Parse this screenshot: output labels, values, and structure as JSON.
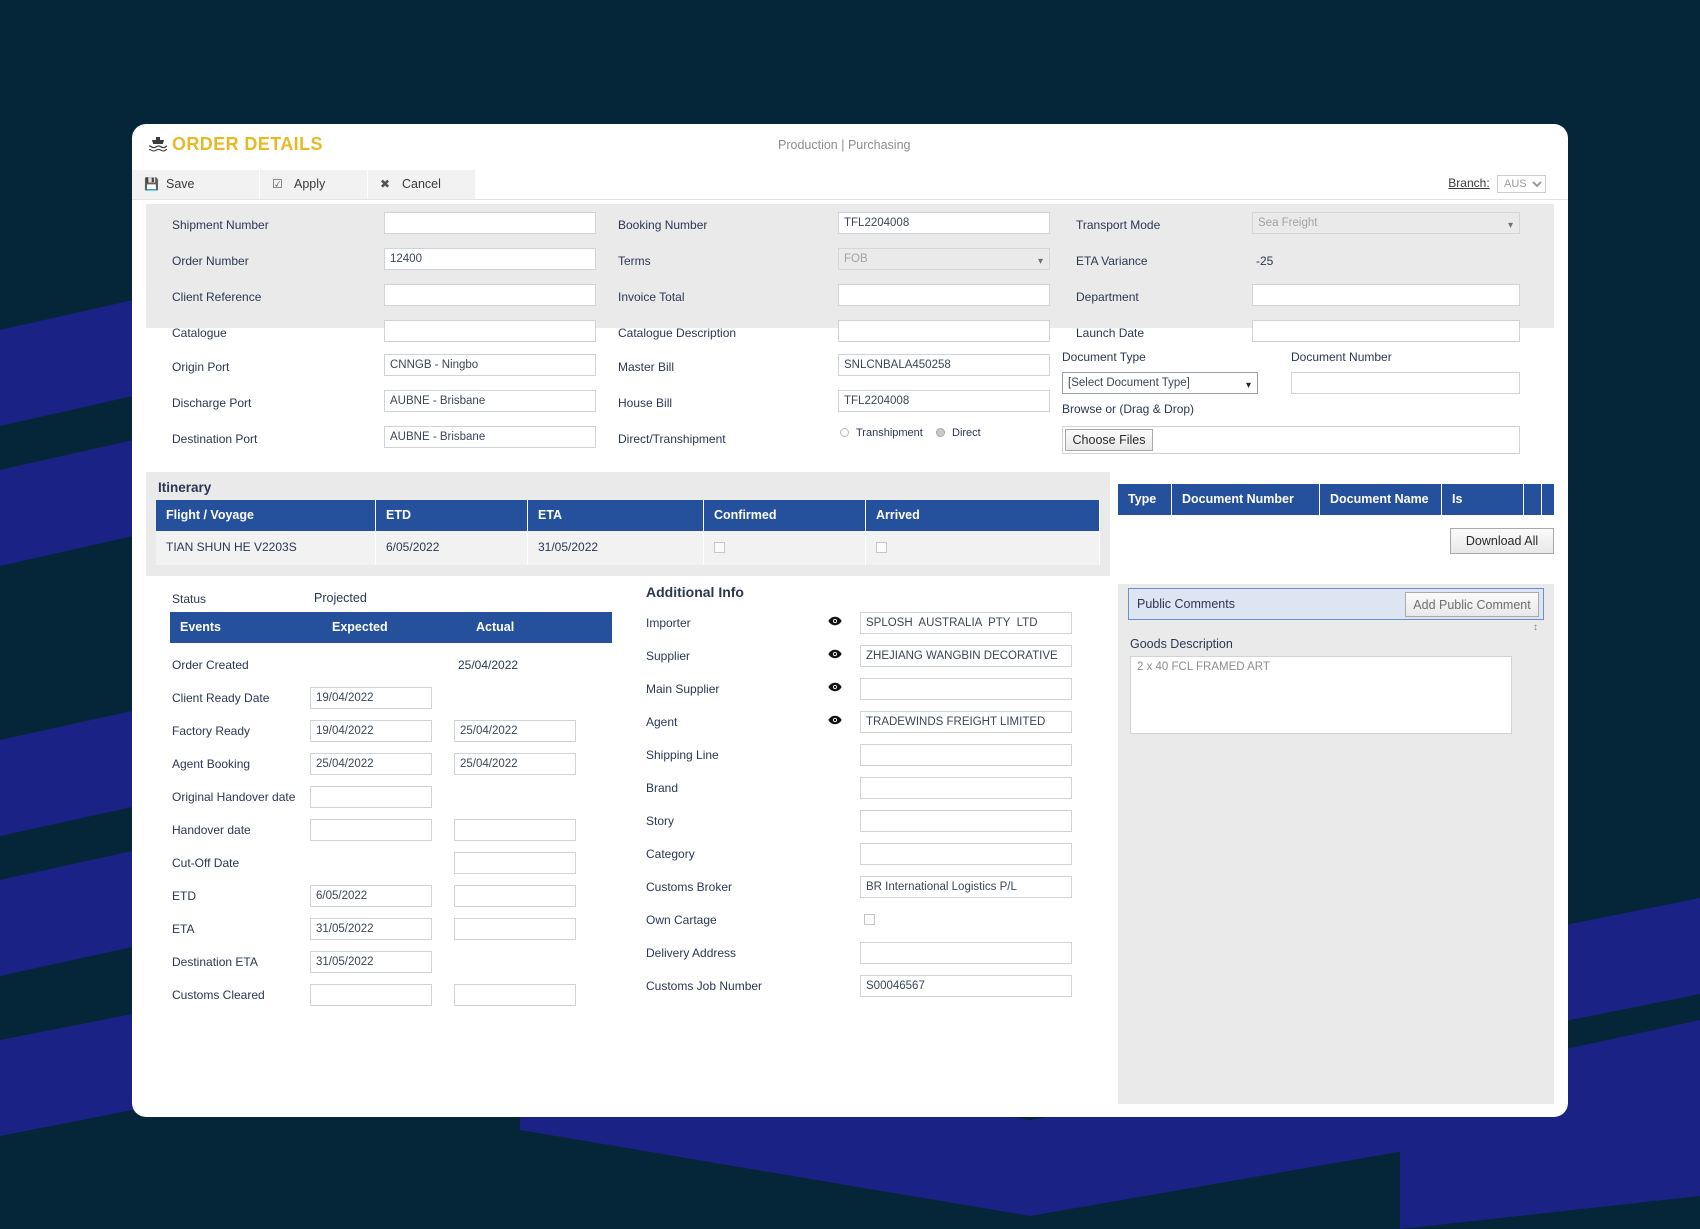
{
  "theme": {
    "bg_dark": "#042638",
    "bg_stripe": "#1b2285",
    "accent_gold": "#e8b927",
    "table_header_blue": "#25509c",
    "panel_grey": "#eaeaea"
  },
  "header": {
    "title": "ORDER DETAILS",
    "ship_icon": "ship-icon",
    "breadcrumb": "Production | Purchasing",
    "branch_label": "Branch:",
    "branch_value": "AUS"
  },
  "toolbar": {
    "save_label": "Save",
    "apply_label": "Apply",
    "cancel_label": "Cancel",
    "save_icon": "save-icon",
    "apply_icon": "checkbox-icon",
    "cancel_icon": "cross-icon"
  },
  "top_form": {
    "col1": [
      {
        "label": "Shipment Number",
        "value": "",
        "type": "text"
      },
      {
        "label": "Order Number",
        "value": "12400",
        "type": "text"
      },
      {
        "label": "Client Reference",
        "value": "",
        "type": "text"
      },
      {
        "label": "Catalogue",
        "value": "",
        "type": "text"
      }
    ],
    "col2": [
      {
        "label": "Booking Number",
        "value": "TFL2204008",
        "type": "text"
      },
      {
        "label": "Terms",
        "value": "FOB",
        "type": "select",
        "disabled": true
      },
      {
        "label": "Invoice Total",
        "value": "",
        "type": "text"
      },
      {
        "label": "Catalogue Description",
        "value": "",
        "type": "text"
      }
    ],
    "col3": [
      {
        "label": "Transport Mode",
        "value": "Sea Freight",
        "type": "select",
        "disabled": true
      },
      {
        "label": "ETA Variance",
        "value": "-25",
        "type": "static"
      },
      {
        "label": "Department",
        "value": "",
        "type": "text"
      },
      {
        "label": "Launch Date",
        "value": "",
        "type": "text"
      }
    ]
  },
  "ports_form": {
    "col1": [
      {
        "label": "Origin Port",
        "value": "CNNGB - Ningbo"
      },
      {
        "label": "Discharge Port",
        "value": "AUBNE - Brisbane"
      },
      {
        "label": "Destination Port",
        "value": "AUBNE - Brisbane"
      }
    ],
    "col2": [
      {
        "label": "Master Bill",
        "value": "SNLCNBALA450258"
      },
      {
        "label": "House Bill",
        "value": "TFL2204008"
      }
    ],
    "direct_transhipment": {
      "label": "Direct/Transhipment",
      "option_transhipment": "Transhipment",
      "option_direct": "Direct",
      "selected": "Direct"
    }
  },
  "documents_upload": {
    "document_type_label": "Document Type",
    "document_type_value": "[Select Document Type]",
    "document_number_label": "Document Number",
    "document_number_value": "",
    "browse_label": "Browse or (Drag & Drop)",
    "choose_files_label": "Choose Files"
  },
  "itinerary": {
    "title": "Itinerary",
    "columns": [
      "Flight / Voyage",
      "ETD",
      "ETA",
      "Confirmed",
      "Arrived"
    ],
    "rows": [
      {
        "voyage": "TIAN SHUN HE V2203S",
        "etd": "6/05/2022",
        "eta": "31/05/2022",
        "confirmed": false,
        "arrived": false
      }
    ]
  },
  "documents_table": {
    "columns": [
      "Type",
      "Document Number",
      "Document Name",
      "Is Approved",
      "",
      ""
    ],
    "rows": [],
    "download_all_label": "Download All"
  },
  "status_block": {
    "status_label": "Status",
    "status_value": "Projected",
    "columns": [
      "Events",
      "Expected",
      "Actual"
    ],
    "rows": [
      {
        "event": "Order Created",
        "expected": "",
        "actual": "25/04/2022",
        "expected_field": false,
        "actual_field": false
      },
      {
        "event": "Client Ready Date",
        "expected": "19/04/2022",
        "actual": "",
        "expected_field": true,
        "actual_field": false
      },
      {
        "event": "Factory Ready",
        "expected": "19/04/2022",
        "actual": "25/04/2022",
        "expected_field": true,
        "actual_field": true
      },
      {
        "event": "Agent Booking",
        "expected": "25/04/2022",
        "actual": "25/04/2022",
        "expected_field": true,
        "actual_field": true
      },
      {
        "event": "Original Handover date",
        "expected": "",
        "actual": "",
        "expected_field": true,
        "actual_field": false
      },
      {
        "event": "Handover date",
        "expected": "",
        "actual": "",
        "expected_field": true,
        "actual_field": true
      },
      {
        "event": "Cut-Off Date",
        "expected": "",
        "actual": "",
        "expected_field": false,
        "actual_field": true
      },
      {
        "event": "ETD",
        "expected": "6/05/2022",
        "actual": "",
        "expected_field": true,
        "actual_field": true
      },
      {
        "event": "ETA",
        "expected": "31/05/2022",
        "actual": "",
        "expected_field": true,
        "actual_field": true
      },
      {
        "event": "Destination ETA",
        "expected": "31/05/2022",
        "actual": "",
        "expected_field": true,
        "actual_field": false
      },
      {
        "event": "Customs Cleared",
        "expected": "",
        "actual": "",
        "expected_field": true,
        "actual_field": true
      }
    ]
  },
  "additional_info": {
    "title": "Additional Info",
    "rows": [
      {
        "label": "Importer",
        "value": "SPLOSH  AUSTRALIA  PTY  LTD",
        "eye": true,
        "type": "text"
      },
      {
        "label": "Supplier",
        "value": "ZHEJIANG WANGBIN DECORATIVE",
        "eye": true,
        "type": "text"
      },
      {
        "label": "Main Supplier",
        "value": "",
        "eye": true,
        "type": "text"
      },
      {
        "label": "Agent",
        "value": "TRADEWINDS FREIGHT LIMITED",
        "eye": true,
        "type": "text"
      },
      {
        "label": "Shipping Line",
        "value": "",
        "eye": false,
        "type": "text"
      },
      {
        "label": "Brand",
        "value": "",
        "eye": false,
        "type": "text"
      },
      {
        "label": "Story",
        "value": "",
        "eye": false,
        "type": "text"
      },
      {
        "label": "Category",
        "value": "",
        "eye": false,
        "type": "text"
      },
      {
        "label": "Customs Broker",
        "value": "BR International Logistics P/L",
        "eye": false,
        "type": "text"
      },
      {
        "label": "Own Cartage",
        "value": "",
        "eye": false,
        "type": "checkbox",
        "checked": false
      },
      {
        "label": "Delivery Address",
        "value": "",
        "eye": false,
        "type": "text"
      },
      {
        "label": "Customs Job Number",
        "value": "S00046567",
        "eye": false,
        "type": "text"
      }
    ]
  },
  "comments_panel": {
    "public_comments_label": "Public Comments",
    "add_public_comment_label": "Add Public Comment",
    "goods_description_label": "Goods Description",
    "goods_description_value": "2 x 40 FCL FRAMED ART"
  }
}
